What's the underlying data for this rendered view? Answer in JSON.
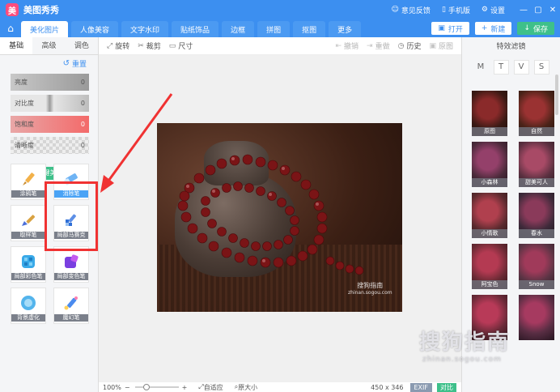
{
  "titlebar": {
    "app_title": "美图秀秀",
    "feedback": "意见反馈",
    "mobile": "手机版",
    "settings": "设置"
  },
  "nav": {
    "tabs": [
      {
        "label": "美化图片",
        "active": true
      },
      {
        "label": "人像美容"
      },
      {
        "label": "文字水印"
      },
      {
        "label": "贴纸饰品"
      },
      {
        "label": "边框"
      },
      {
        "label": "拼图"
      },
      {
        "label": "抠图"
      },
      {
        "label": "更多"
      }
    ],
    "open": "打开",
    "new": "新建",
    "save": "保存"
  },
  "left": {
    "tabs": [
      "基础",
      "高级",
      "调色"
    ],
    "reset": "重置",
    "sliders": [
      {
        "label": "亮度",
        "value": "0"
      },
      {
        "label": "对比度",
        "value": "0"
      },
      {
        "label": "饱和度",
        "value": "0"
      },
      {
        "label": "清晰度",
        "value": "0"
      }
    ],
    "beautify": "一键美化",
    "tools": [
      {
        "label": "涂鸦笔"
      },
      {
        "label": "消除笔"
      },
      {
        "label": "取样笔"
      },
      {
        "label": "局部马赛克"
      },
      {
        "label": "局部彩色笔"
      },
      {
        "label": "局部变色笔"
      },
      {
        "label": "背景虚化"
      },
      {
        "label": "魔幻笔"
      }
    ]
  },
  "toolbar": {
    "rotate": "旋转",
    "crop": "裁剪",
    "size": "尺寸",
    "undo": "撤销",
    "redo": "重做",
    "history": "历史",
    "original": "原图"
  },
  "photo": {
    "watermark": "搜狗指南",
    "watermark_url": "zhinan.sogou.com"
  },
  "status": {
    "zoom": "100%",
    "fit": "自适应",
    "actual": "原大小",
    "dims": "450 x 346",
    "exif": "EXIF",
    "compare": "对比"
  },
  "right": {
    "title": "特效滤镜",
    "tabs": [
      "M",
      "T",
      "V",
      "S"
    ],
    "filters": [
      {
        "label": "原图"
      },
      {
        "label": "自然"
      },
      {
        "label": "小森林"
      },
      {
        "label": "甜美可人"
      },
      {
        "label": "小情歌"
      },
      {
        "label": "春水"
      },
      {
        "label": "阿宝色"
      },
      {
        "label": "Snow"
      },
      {
        "label": ""
      },
      {
        "label": ""
      }
    ]
  },
  "page_watermark": {
    "text": "搜狗指南",
    "url": "zhinan.sogou.com"
  },
  "colors": {
    "brand_blue": "#3c8ff0",
    "save_green": "#3ec08a",
    "highlight_red": "#f03232"
  }
}
